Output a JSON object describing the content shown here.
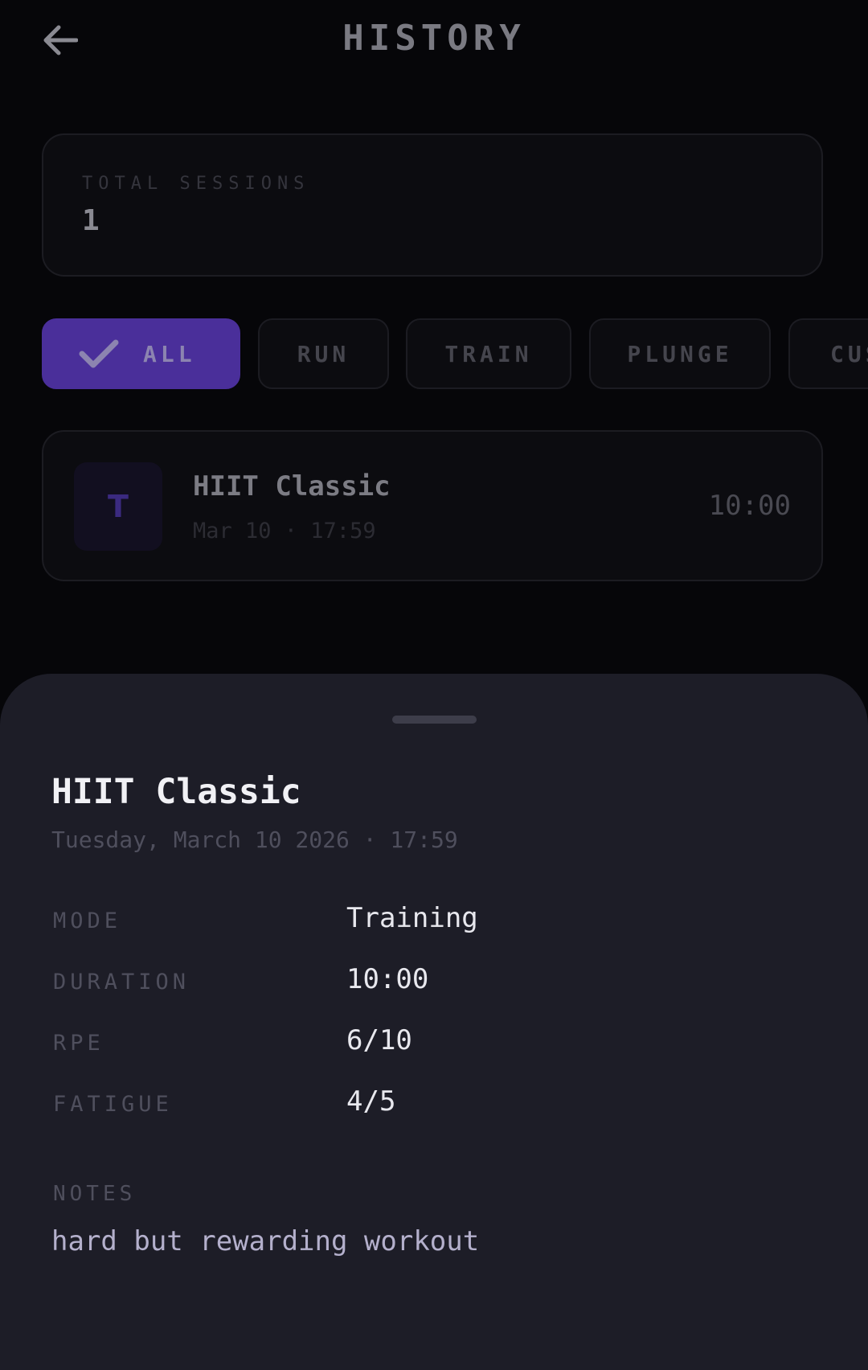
{
  "header": {
    "title": "HISTORY",
    "back_icon": "arrow-left-icon"
  },
  "stats": {
    "total_sessions_label": "TOTAL SESSIONS",
    "total_sessions_value": "1"
  },
  "filters": {
    "selected": "ALL",
    "check_icon": "check-icon",
    "chips": [
      {
        "label": "ALL"
      },
      {
        "label": "RUN"
      },
      {
        "label": "TRAIN"
      },
      {
        "label": "PLUNGE"
      },
      {
        "label": "CUS"
      }
    ]
  },
  "sessions": [
    {
      "avatar_letter": "T",
      "name": "HIIT Classic",
      "meta": "Mar 10 · 17:59",
      "duration": "10:00"
    }
  ],
  "sheet": {
    "title": "HIIT Classic",
    "subtitle": "Tuesday, March 10 2026 · 17:59",
    "details": [
      {
        "label": "MODE",
        "value": "Training"
      },
      {
        "label": "DURATION",
        "value": "10:00"
      },
      {
        "label": "RPE",
        "value": "6/10"
      },
      {
        "label": "FATIGUE",
        "value": "4/5"
      }
    ],
    "notes_label": "NOTES",
    "notes": "hard but rewarding workout"
  },
  "colors": {
    "background": "#060609",
    "accent": "#4a2f9a",
    "sheet_background": "#1d1d27"
  }
}
